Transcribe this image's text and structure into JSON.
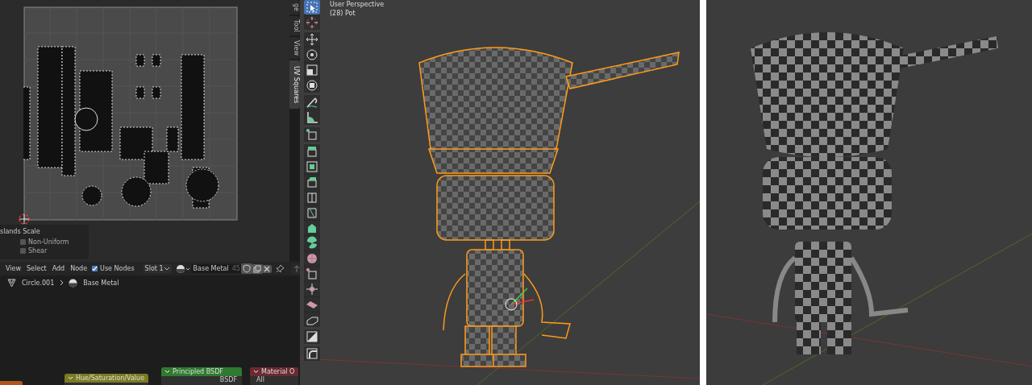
{
  "uv_editor": {
    "sidebar_tabs": [
      {
        "label": "ge",
        "selected": false
      },
      {
        "label": "Tool",
        "selected": false
      },
      {
        "label": "View",
        "selected": false
      },
      {
        "label": "UV Squares",
        "selected": true
      }
    ],
    "panel": {
      "title": "slands Scale",
      "options": [
        {
          "label": "Non-Uniform",
          "checked": false
        },
        {
          "label": "Shear",
          "checked": false
        }
      ]
    }
  },
  "node_editor": {
    "menu": [
      "View",
      "Select",
      "Add",
      "Node"
    ],
    "use_nodes": {
      "label": "Use Nodes",
      "checked": true
    },
    "slot": "Slot 1",
    "material": "Base Metal",
    "users": "45",
    "breadcrumb": [
      "Circle.001",
      "Base Metal"
    ],
    "nodes": [
      {
        "title": "Hue/Saturation/Value",
        "color": "#7a7a22"
      },
      {
        "title": "Principled BSDF",
        "color": "#2f7a2f",
        "socket": "BSDF"
      },
      {
        "title": "Material O",
        "color": "#6a2a30",
        "socket": "All"
      }
    ]
  },
  "viewport": {
    "title": "User Perspective",
    "object": "(28) Pot",
    "tool_groups": [
      [
        {
          "kind": "select",
          "selected": true
        },
        {
          "kind": "cursor",
          "selected": false
        }
      ],
      [
        {
          "kind": "move",
          "selected": false
        },
        {
          "kind": "rotate",
          "selected": false
        },
        {
          "kind": "scale",
          "selected": false
        },
        {
          "kind": "transform",
          "selected": false
        }
      ],
      [
        {
          "kind": "annotate",
          "selected": false
        },
        {
          "kind": "measure",
          "selected": false
        }
      ],
      [
        {
          "kind": "add-cube",
          "selected": false
        }
      ],
      [
        {
          "kind": "extrude",
          "selected": false
        },
        {
          "kind": "inset",
          "selected": false
        },
        {
          "kind": "bevel",
          "selected": false
        },
        {
          "kind": "loop-cut",
          "selected": false
        },
        {
          "kind": "knife",
          "selected": false
        },
        {
          "kind": "poly-build",
          "selected": false
        },
        {
          "kind": "spin",
          "selected": false
        },
        {
          "kind": "smooth",
          "selected": false
        },
        {
          "kind": "vertex-add",
          "selected": false
        },
        {
          "kind": "shrink",
          "selected": false
        },
        {
          "kind": "shear",
          "selected": false
        },
        {
          "kind": "rip",
          "selected": false
        }
      ],
      [
        {
          "kind": "corner",
          "selected": false
        }
      ],
      [
        {
          "kind": "curve",
          "selected": false
        }
      ]
    ]
  }
}
